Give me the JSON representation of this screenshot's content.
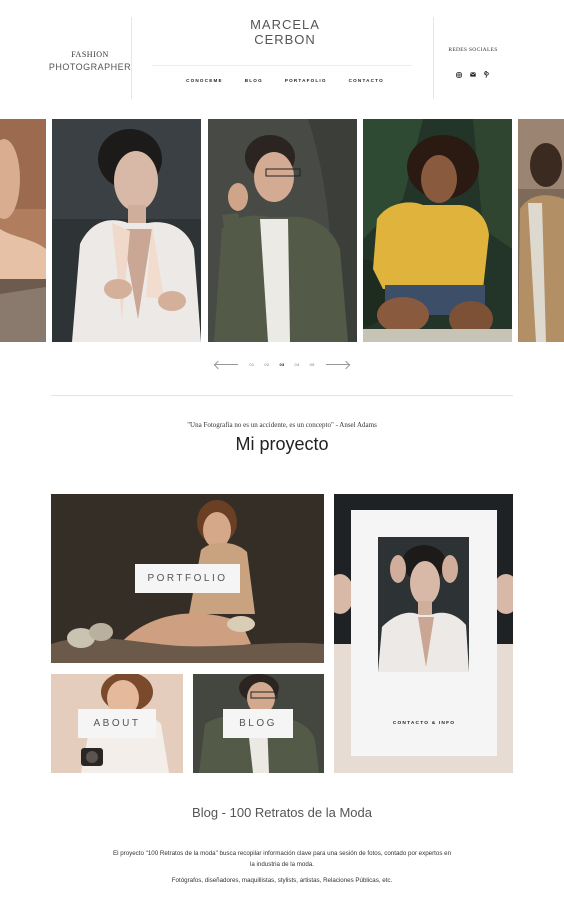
{
  "header": {
    "tagline_line1": "FASHION",
    "tagline_line2": "PHOTOGRAPHER",
    "logo_line1": "MARCELA",
    "logo_line2": "CERBON",
    "nav": [
      "CONOCEME",
      "BLOG",
      "PORTAFOLIO",
      "CONTACTO"
    ],
    "social_title": "REDES SOCIALES",
    "social_icons": [
      "instagram-icon",
      "mail-icon",
      "pinterest-icon"
    ]
  },
  "carousel": {
    "pages": [
      "01",
      "02",
      "03",
      "04",
      "05"
    ],
    "active_page": "03"
  },
  "intro": {
    "quote": "\"Una Fotografía no es un accidente, es un concepto\" - Ansel Adams",
    "title": "Mi proyecto"
  },
  "tiles": {
    "portfolio": "PORTFOLIO",
    "about": "ABOUT",
    "blog": "BLOG",
    "contact": "CONTACTO & INFO"
  },
  "blog": {
    "title": "Blog - 100 Retratos de la Moda",
    "paragraph": "El proyecto \"100 Retratos de la moda\" busca recopilar información clave para una sesión de fotos, contado por expertos en la industria de la moda.",
    "roles": "Fotógrafos, diseñadores, maquillistas, stylists, artistas, Relaciones Públicas, etc."
  }
}
